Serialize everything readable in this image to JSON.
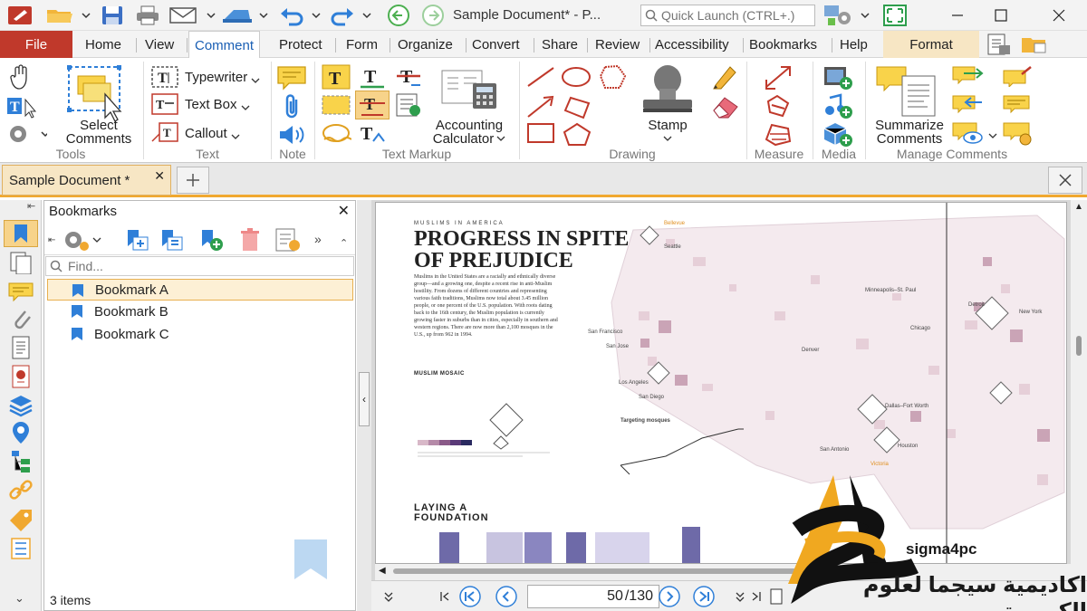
{
  "window": {
    "title": "Sample Document* - P...",
    "quick_launch_placeholder": "Quick Launch (CTRL+.)"
  },
  "menu": {
    "file": "File",
    "tabs": [
      "Home",
      "View",
      "Comment",
      "Protect",
      "Form",
      "Organize",
      "Convert",
      "Share",
      "Review",
      "Accessibility",
      "Bookmarks",
      "Help"
    ],
    "active_tab": "Comment",
    "format": "Format"
  },
  "ribbon": {
    "groups": {
      "tools": "Tools",
      "text": "Text",
      "note": "Note",
      "text_markup": "Text Markup",
      "drawing": "Drawing",
      "measure": "Measure",
      "media": "Media",
      "manage_comments": "Manage Comments"
    },
    "select_comments": [
      "Select",
      "Comments"
    ],
    "typewriter": "Typewriter",
    "text_box": "Text Box",
    "callout": "Callout",
    "accounting_calculator": [
      "Accounting",
      "Calculator"
    ],
    "stamp": "Stamp",
    "summarize_comments": [
      "Summarize",
      "Comments"
    ]
  },
  "doc_tab": {
    "label": "Sample Document *"
  },
  "bookmarks": {
    "title": "Bookmarks",
    "find_placeholder": "Find...",
    "items": [
      "Bookmark A",
      "Bookmark B",
      "Bookmark C"
    ],
    "selected_index": 0,
    "status": "3 items"
  },
  "document": {
    "kicker": "MUSLIMS IN AMERICA",
    "headline": "PROGRESS IN SPITE OF PREJUDICE",
    "body": "Muslims in the United States are a racially and ethnically diverse group—and a growing one, despite a recent rise in anti-Muslim hostility. From dozens of different countries and representing various faith traditions, Muslims now total about 3.45 million people, or one percent of the U.S. population. With roots dating back to the 16th century, the Muslim population is currently growing faster in suburbs than in cities, especially in southern and western regions. There are now more than 2,100 mosques in the U.S., up from 962 in 1994.",
    "sub1": "MUSLIM MOSAIC",
    "sub2": [
      "LAYING A",
      "FOUNDATION"
    ],
    "map_labels": [
      "Bellevue",
      "Seattle",
      "San Francisco",
      "San Jose",
      "Los Angeles",
      "San Diego",
      "Denver",
      "Minneapolis–St. Paul",
      "Chicago",
      "Detroit",
      "New York",
      "Dallas–Fort Worth",
      "Houston",
      "San Antonio",
      "Victoria",
      "Targeting mosques"
    ]
  },
  "navigation": {
    "current_page": "50",
    "total_pages": "/130"
  },
  "watermark": {
    "brand": "sigma4pc",
    "arabic": "اكاديمية سيجما لعلوم الكمبيوتر"
  },
  "colors": {
    "accent": "#f0a830",
    "file_tab": "#c0392b",
    "active_tab_text": "#1a5fb4",
    "bookmark_icon": "#2f7fd8"
  }
}
